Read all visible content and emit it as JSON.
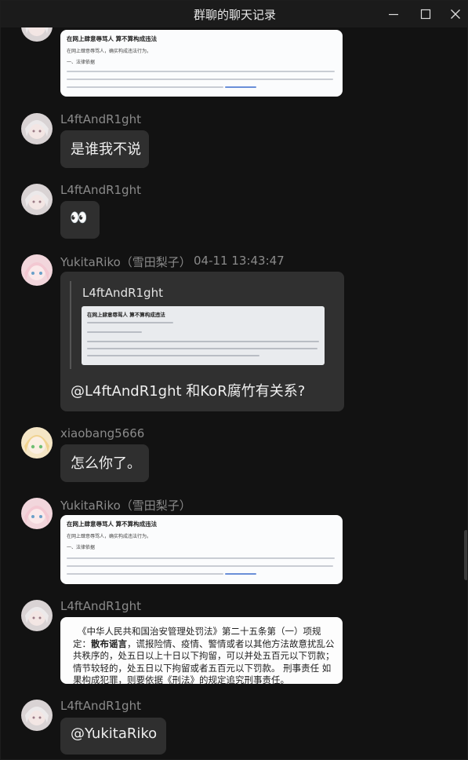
{
  "window": {
    "title": "群聊的聊天记录"
  },
  "messages": {
    "m1": {
      "sender": "L4ftAndR1ght",
      "text": "是谁我不说"
    },
    "m2": {
      "sender": "L4ftAndR1ght",
      "text": "👀"
    },
    "m3": {
      "sender": "YukitaRiko（雪田梨子）",
      "time": "04-11 13:43:47",
      "quote_sender": "L4ftAndR1ght",
      "text": "@L4ftAndR1ght 和KoR腐竹有关系?"
    },
    "m4": {
      "sender": "xiaobang5666",
      "text": "怎么你了。"
    },
    "m5": {
      "sender": "YukitaRiko（雪田梨子）"
    },
    "m6": {
      "sender": "L4ftAndR1ght",
      "law_before": "《中华人民共和国治安管理处罚法》第二十五条第（一）项规定：",
      "law_bold": "散布谣言",
      "law_after": "，谎报险情、疫情、警情或者以其他方法故意扰乱公共秩序的，处五日以上十日以下拘留，可以并处五百元以下罚款；情节较轻的，处五日以下拘留或者五百元以下罚款。 刑事责任 如果构成犯罪，则要依据《刑法》的规定追究刑事责任。"
    },
    "m7": {
      "sender": "L4ftAndR1ght",
      "text": "@YukitaRiko"
    }
  },
  "shared_card": {
    "heading": "在网上肆意辱骂人 算不算构成违法",
    "line1": "在网上肆意辱骂人，确实构成违法行为。",
    "line2": "一、法律依据"
  }
}
